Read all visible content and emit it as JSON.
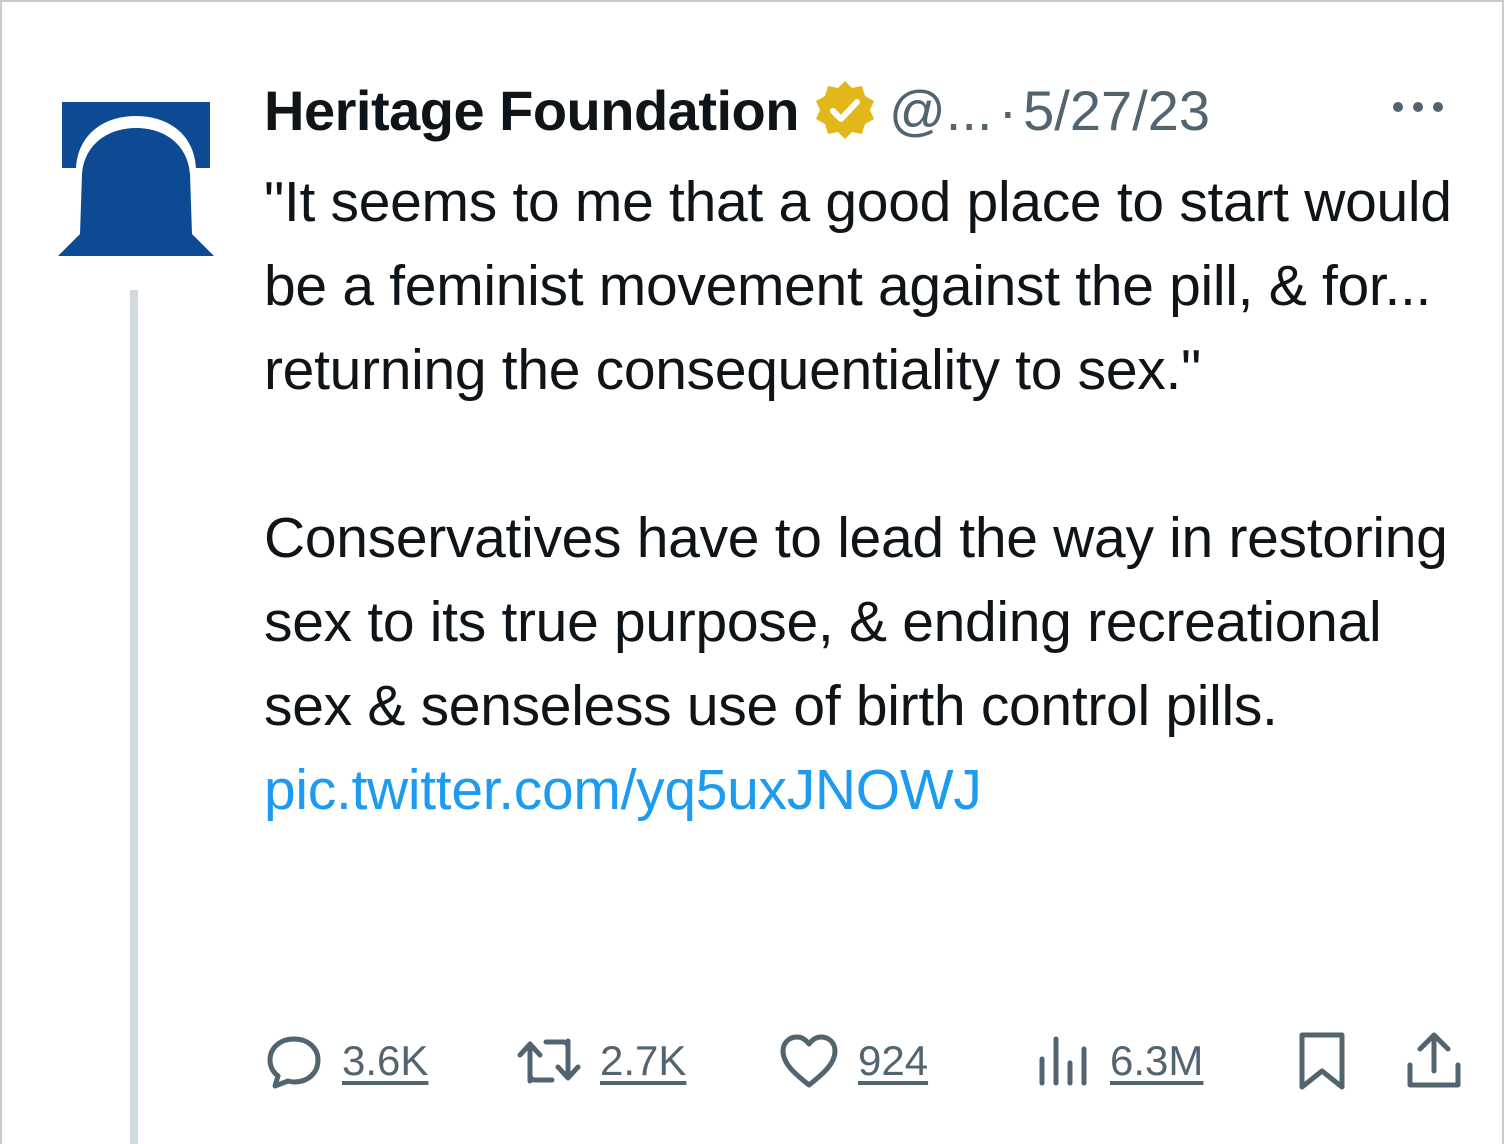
{
  "author": {
    "display_name": "Heritage Foundation",
    "handle": "@...",
    "separator": "·",
    "date": "5/27/23",
    "verified_badge_color": "#e2b719",
    "avatar_color": "#0d4a93"
  },
  "tweet": {
    "paragraph_1": "\"It seems to me that a good place to start would be a feminist movement against the pill, & for... returning the consequentiality to sex.\"",
    "paragraph_2": "Conservatives have to lead the way in restoring sex to its true purpose, & ending recreational sex & senseless use of birth control pills.",
    "link_text": "pic.twitter.com/yq5uxJNOWJ",
    "link_color": "#1d9bf0"
  },
  "actions": {
    "replies": "3.6K",
    "retweets": "2.7K",
    "likes": "924",
    "views": "6.3M"
  },
  "icons": [
    "more-icon",
    "verified-icon",
    "reply-icon",
    "retweet-icon",
    "like-icon",
    "views-icon",
    "bookmark-icon",
    "share-icon"
  ]
}
